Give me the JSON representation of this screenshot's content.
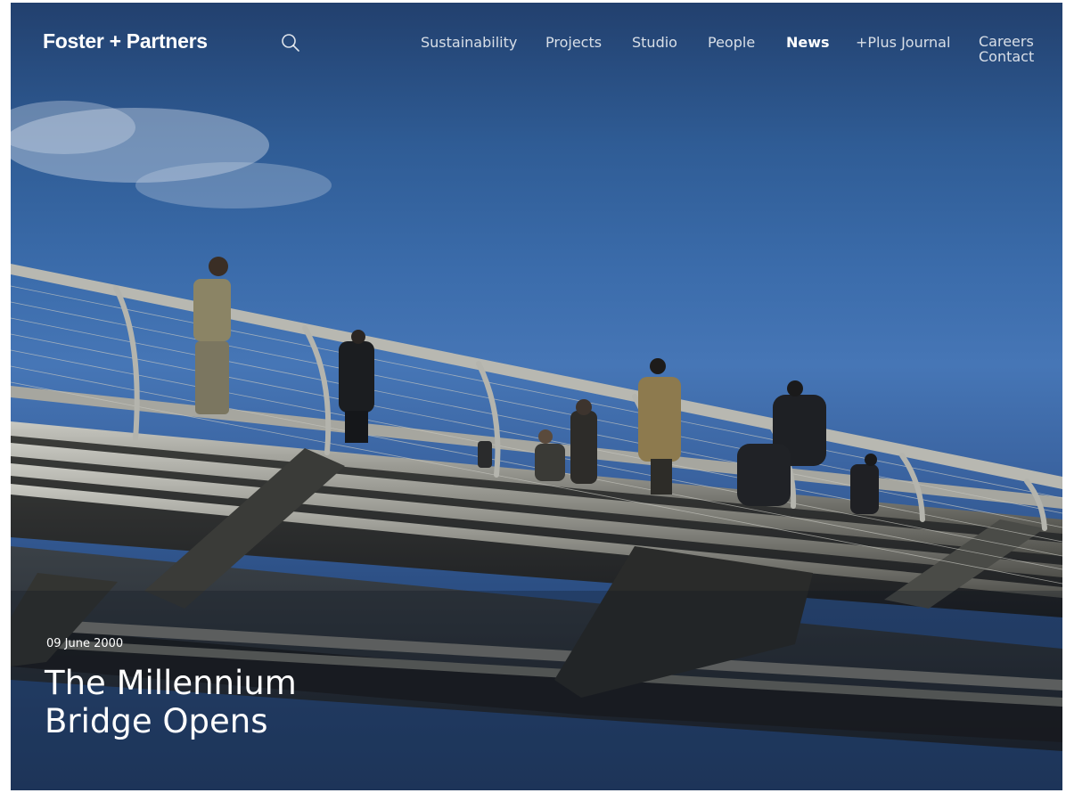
{
  "brand": {
    "logo": "Foster + Partners"
  },
  "nav": {
    "items": [
      "Sustainability",
      "Projects",
      "Studio",
      "People",
      "News",
      "+Plus Journal"
    ],
    "active": "News",
    "stacked": [
      "Careers",
      "Contact"
    ]
  },
  "icons": {
    "search": "search-icon"
  },
  "hero": {
    "date": "09 June 2000",
    "title_line1": "The Millennium",
    "title_line2": "Bridge Opens"
  },
  "colors": {
    "sky_top": "#22406e",
    "sky_mid": "#4676b6",
    "text": "#ffffff"
  }
}
